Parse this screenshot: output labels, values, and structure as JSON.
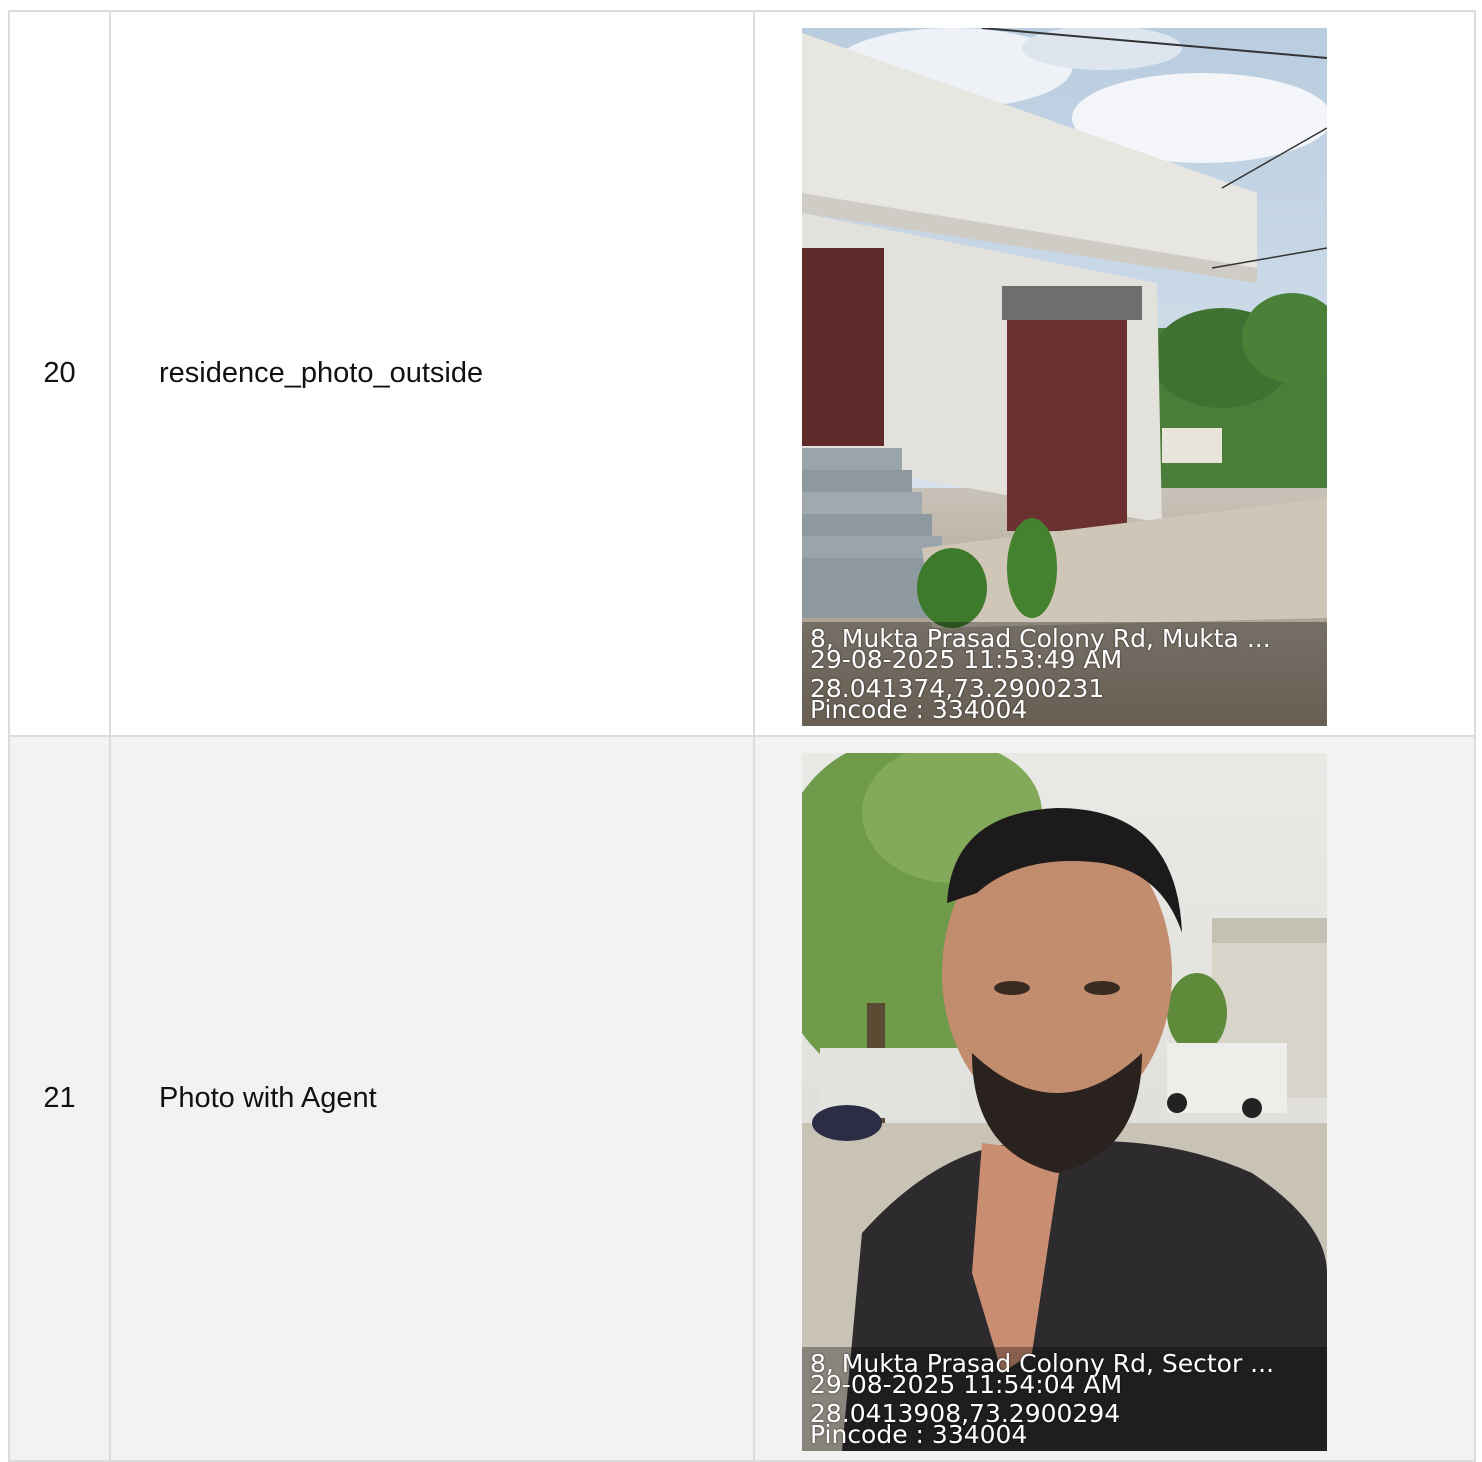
{
  "rows": [
    {
      "number": "20",
      "label": "residence_photo_outside",
      "photo": {
        "stamp": {
          "address": "8, Mukta Prasad Colony Rd, Mukta ...",
          "datetime": "29-08-2025 11:53:49 AM",
          "coords": "28.041374,73.2900231",
          "pincode": "Pincode : 334004"
        }
      }
    },
    {
      "number": "21",
      "label": "Photo with Agent",
      "photo": {
        "stamp": {
          "address": "8, Mukta Prasad Colony Rd, Sector ...",
          "datetime": "29-08-2025 11:54:04 AM",
          "coords": "28.0413908,73.2900294",
          "pincode": "Pincode : 334004"
        }
      }
    }
  ],
  "colors": {
    "border": "#dcdcdc",
    "alt_row": "#f2f2f2"
  }
}
